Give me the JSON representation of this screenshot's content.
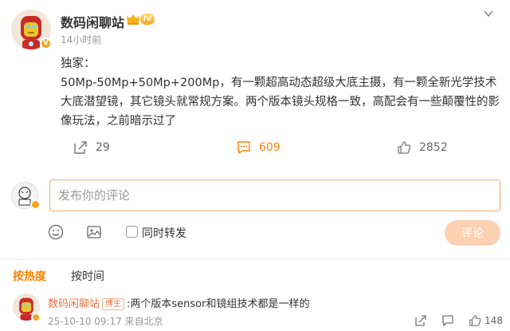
{
  "author": {
    "name": "数码闲聊站",
    "level": "IV",
    "time": "14小时前"
  },
  "post": {
    "text": "独家：\n50Mp-50Mp+50Mp+200Mp，有一颗超高动态超级大底主摄，有一颗全新光学技术大底潜望镜，其它镜头就常规方案。两个版本镜头规格一致，高配会有一些颠覆性的影像玩法，之前暗示过了"
  },
  "actions": {
    "reposts": "29",
    "comments": "609",
    "likes": "2852"
  },
  "composer": {
    "placeholder": "发布你的评论",
    "repost_label": "同时转发",
    "submit_label": "评论"
  },
  "tabs": [
    "按热度",
    "按时间"
  ],
  "reply": {
    "author": "数码闲聊站",
    "tag": "博主",
    "text": ":两个版本sensor和镜组技术都是一样的",
    "meta": "25-10-10 09:17 来自北京",
    "likes": "148"
  },
  "colors": {
    "accent": "#ff8200",
    "name_link": "#eb7340",
    "submit_disabled": "#fcd1b3"
  }
}
